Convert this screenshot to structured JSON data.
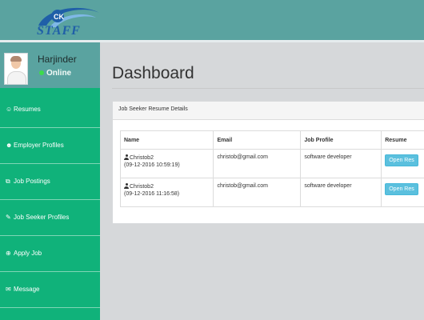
{
  "logo": {
    "text": "STAFF"
  },
  "user": {
    "name": "Harjinder",
    "status": "Online"
  },
  "nav": [
    {
      "label": "Resumes",
      "icon": "resume-icon",
      "glyph": "☺"
    },
    {
      "label": "Employer Profiles",
      "icon": "users-icon",
      "glyph": "☻"
    },
    {
      "label": "Job Postings",
      "icon": "copy-icon",
      "glyph": "⧉"
    },
    {
      "label": "Job Seeker Profiles",
      "icon": "wrench-icon",
      "glyph": "✎"
    },
    {
      "label": "Apply Job",
      "icon": "sitemap-icon",
      "glyph": "⊕"
    },
    {
      "label": "Message",
      "icon": "comment-icon",
      "glyph": "✉"
    }
  ],
  "page": {
    "title": "Dashboard"
  },
  "panel": {
    "title": "Job Seeker Resume Details",
    "columns": [
      "Name",
      "Email",
      "Job Profile",
      "Resume"
    ],
    "rows": [
      {
        "name": "Christob2",
        "date": "(09-12-2016 10:59:19)",
        "email": "christob@gmail.com",
        "profile": "software developer",
        "resume_button": "Open Res"
      },
      {
        "name": "Christob2",
        "date": "(09-12-2016 11:16:58)",
        "email": "christob@gmail.com",
        "profile": "software developer",
        "resume_button": "Open Res"
      }
    ]
  },
  "colors": {
    "header": "#5aa3a0",
    "sidebar": "#10b27a",
    "status_online": "#3ddc4a",
    "button_info": "#5bc0de"
  }
}
